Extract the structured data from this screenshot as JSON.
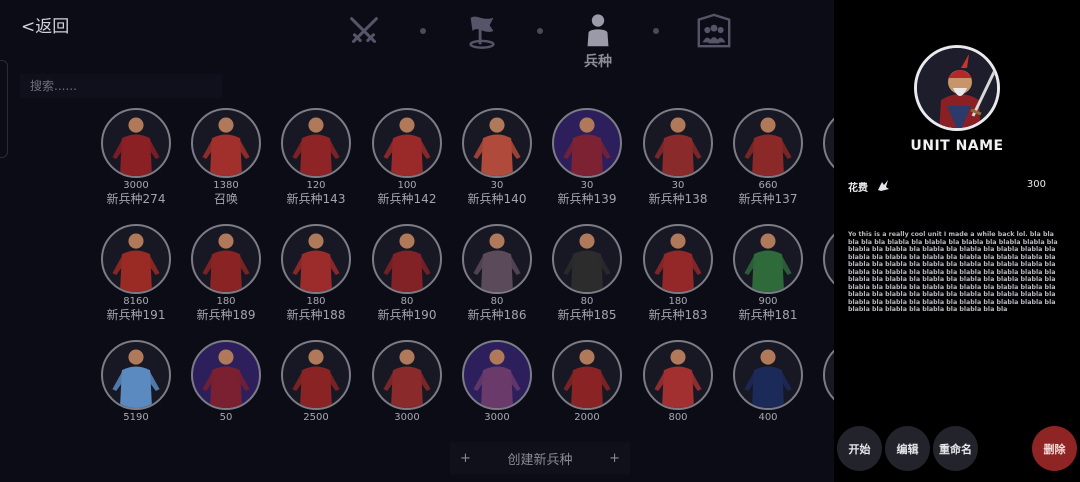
{
  "nav": {
    "back_label": "<返回"
  },
  "search": {
    "placeholder": "搜索......"
  },
  "tabs": {
    "active_label": "兵种"
  },
  "units": [
    {
      "cost": "3000",
      "name": "新兵种274",
      "color": "#8a1f24"
    },
    {
      "cost": "1380",
      "name": "召唤",
      "color": "#a1302c"
    },
    {
      "cost": "120",
      "name": "新兵种143",
      "color": "#8e2426"
    },
    {
      "cost": "100",
      "name": "新兵种142",
      "color": "#9a2a2a"
    },
    {
      "cost": "30",
      "name": "新兵种140",
      "color": "#b04a3a"
    },
    {
      "cost": "30",
      "name": "新兵种139",
      "color": "#7d2232",
      "purple": true
    },
    {
      "cost": "30",
      "name": "新兵种138",
      "color": "#8a2a2a"
    },
    {
      "cost": "660",
      "name": "新兵种137",
      "color": "#8b2828"
    },
    {
      "cost": "8160",
      "name": "新兵种191",
      "color": "#9a2a24"
    },
    {
      "cost": "180",
      "name": "新兵种189",
      "color": "#8a2424"
    },
    {
      "cost": "180",
      "name": "新兵种188",
      "color": "#9c2c2c"
    },
    {
      "cost": "80",
      "name": "新兵种190",
      "color": "#822226"
    },
    {
      "cost": "80",
      "name": "新兵种186",
      "color": "#5a4a5a"
    },
    {
      "cost": "80",
      "name": "新兵种185",
      "color": "#2c2c2c"
    },
    {
      "cost": "180",
      "name": "新兵种183",
      "color": "#942828"
    },
    {
      "cost": "900",
      "name": "新兵种181",
      "color": "#2e6a3a"
    },
    {
      "cost": "5190",
      "name": "",
      "color": "#5a8ac0"
    },
    {
      "cost": "50",
      "name": "",
      "color": "#7a2030",
      "purple": true
    },
    {
      "cost": "2500",
      "name": "",
      "color": "#8a2424"
    },
    {
      "cost": "3000",
      "name": "",
      "color": "#8a2a2a"
    },
    {
      "cost": "3000",
      "name": "",
      "color": "#6a3a6a",
      "purple": true
    },
    {
      "cost": "2000",
      "name": "",
      "color": "#8a2424"
    },
    {
      "cost": "800",
      "name": "",
      "color": "#a23030"
    },
    {
      "cost": "400",
      "name": "",
      "color": "#1c2a5a"
    }
  ],
  "create": {
    "label": "创建新兵种",
    "left": "+",
    "right": "+"
  },
  "panel": {
    "unit_name": "UNIT NAME",
    "cost_label": "花费",
    "cost_value": "300",
    "description": "Yo this is a really cool unit I made a while back lol. bla bla bla bla bla blabla bla blabla bla blabla bla blabla blabla bla blabla bla blabla bla blabla bla blabla bla blabla blabla bla blabla bla blabla bla blabla bla blabla bla blabla blabla bla blabla bla blabla bla blabla bla blabla bla blabla blabla bla blabla bla blabla bla blabla bla blabla bla blabla blabla bla blabla bla blabla bla blabla bla blabla bla blabla blabla bla blabla bla blabla bla blabla bla blabla bla blabla blabla bla blabla bla blabla bla blabla bla blabla bla blabla blabla bla blabla bla blabla bla blabla bla blabla bla blabla blabla bla blabla bla blabla bla blabla bla blabla bla bla",
    "buttons": {
      "start": "开始",
      "edit": "编辑",
      "rename": "重命名",
      "delete": "删除"
    }
  },
  "colors": {
    "background": "#0c0c16",
    "panel": "#000000",
    "delete": "#8e2424"
  }
}
